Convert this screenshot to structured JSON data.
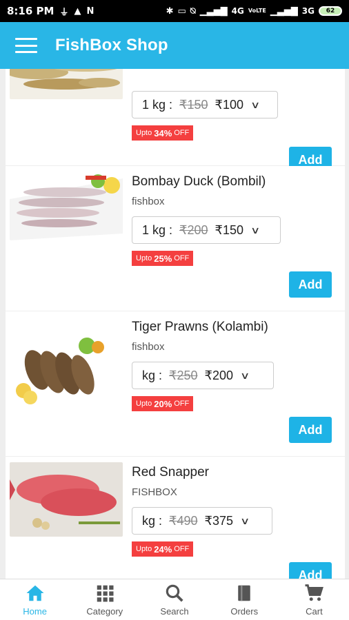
{
  "status_bar": {
    "time": "8:16 PM",
    "network_right": "4G",
    "volte": "VoLTE",
    "network2": "3G",
    "battery": "62"
  },
  "header": {
    "title": "FishBox Shop"
  },
  "products": [
    {
      "name": "",
      "brand": "",
      "unit": "1 kg :",
      "mrp": "₹150",
      "price": "₹100",
      "discount_prefix": "Upto",
      "discount": "34%",
      "discount_suffix": "OFF",
      "add_label": "Add"
    },
    {
      "name": "Bombay Duck (Bombil)",
      "brand": "fishbox",
      "unit": "1 kg :",
      "mrp": "₹200",
      "price": "₹150",
      "discount_prefix": "Upto",
      "discount": "25%",
      "discount_suffix": "OFF",
      "add_label": "Add"
    },
    {
      "name": "Tiger Prawns (Kolambi)",
      "brand": "fishbox",
      "unit": "kg :",
      "mrp": "₹250",
      "price": "₹200",
      "discount_prefix": "Upto",
      "discount": "20%",
      "discount_suffix": "OFF",
      "add_label": "Add"
    },
    {
      "name": "Red Snapper",
      "brand": "FISHBOX",
      "unit": "kg :",
      "mrp": "₹490",
      "price": "₹375",
      "discount_prefix": "Upto",
      "discount": "24%",
      "discount_suffix": "OFF",
      "add_label": "Add"
    }
  ],
  "bottom_nav": [
    {
      "label": "Home",
      "icon": "home-icon",
      "active": true
    },
    {
      "label": "Category",
      "icon": "grid-icon",
      "active": false
    },
    {
      "label": "Search",
      "icon": "search-icon",
      "active": false
    },
    {
      "label": "Orders",
      "icon": "book-icon",
      "active": false
    },
    {
      "label": "Cart",
      "icon": "cart-icon",
      "active": false
    }
  ],
  "colors": {
    "accent": "#29b6e6",
    "discount_badge": "#f43f3f"
  }
}
